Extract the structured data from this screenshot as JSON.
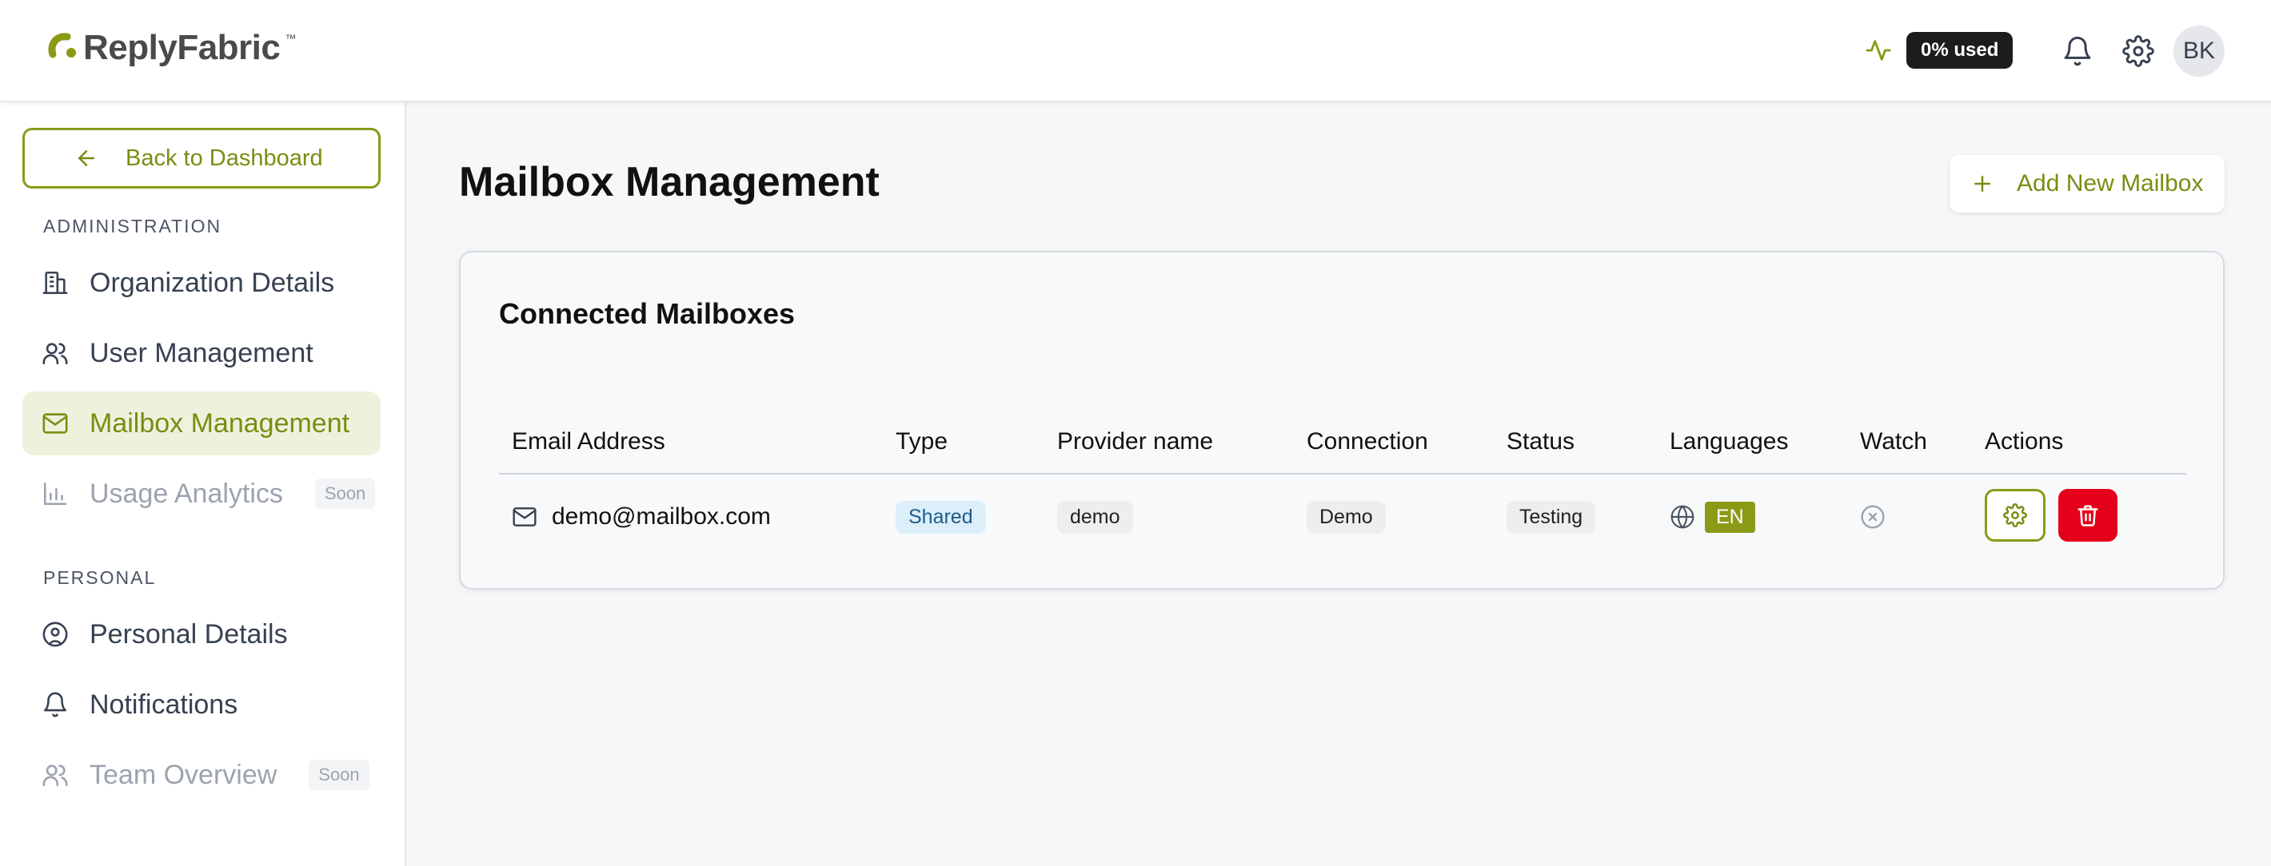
{
  "brand": {
    "name": "ReplyFabric",
    "trademark": "™",
    "accent_color": "#8a9a16"
  },
  "header": {
    "usage_label": "0% used",
    "avatar_initials": "BK",
    "icons": [
      "activity-icon",
      "bell-icon",
      "gear-icon"
    ]
  },
  "sidebar": {
    "back_button": "Back to Dashboard",
    "sections": {
      "administration": "ADMINISTRATION",
      "personal": "PERSONAL"
    },
    "items": {
      "organization": {
        "label": "Organization Details",
        "icon": "building-icon"
      },
      "users": {
        "label": "User Management",
        "icon": "users-icon"
      },
      "mailbox": {
        "label": "Mailbox Management",
        "icon": "mail-icon",
        "active": true
      },
      "analytics": {
        "label": "Usage Analytics",
        "icon": "bar-chart-icon",
        "badge": "Soon"
      },
      "personal": {
        "label": "Personal Details",
        "icon": "user-circle-icon"
      },
      "notifications": {
        "label": "Notifications",
        "icon": "bell-icon"
      },
      "team": {
        "label": "Team Overview",
        "icon": "users-icon",
        "badge": "Soon"
      }
    }
  },
  "main": {
    "title": "Mailbox Management",
    "add_button": "Add New Mailbox",
    "card": {
      "title": "Connected Mailboxes",
      "columns": {
        "email": "Email Address",
        "type": "Type",
        "provider": "Provider name",
        "connection": "Connection",
        "status": "Status",
        "languages": "Languages",
        "watch": "Watch",
        "actions": "Actions"
      },
      "rows": [
        {
          "email": "demo@mailbox.com",
          "type": "Shared",
          "provider": "demo",
          "connection": "Demo",
          "status": "Testing",
          "language": "EN",
          "watch": "off"
        }
      ]
    }
  }
}
